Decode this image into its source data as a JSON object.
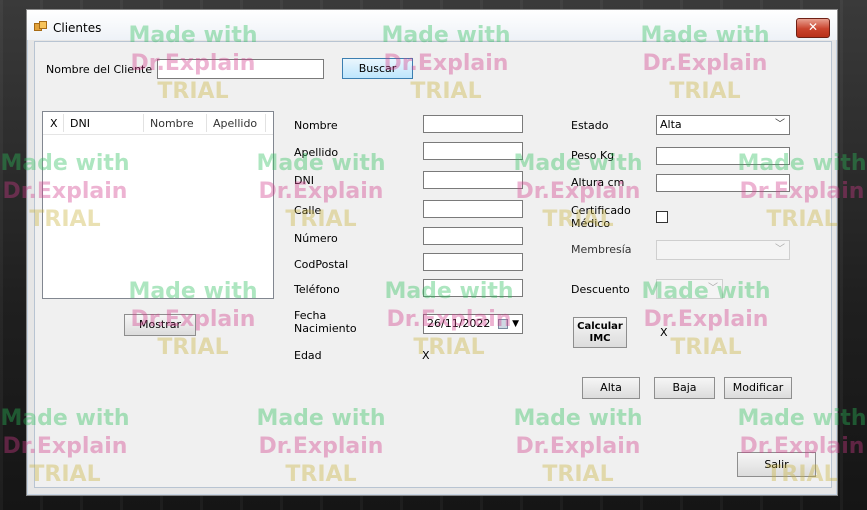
{
  "window": {
    "title": "Clientes",
    "close_glyph": "✕"
  },
  "search": {
    "label": "Nombre del Cliente",
    "value": "",
    "button": "Buscar"
  },
  "listview": {
    "columns": [
      "X",
      "DNI",
      "Nombre",
      "Apellido"
    ],
    "rows": []
  },
  "mostrar_button": "Mostrar",
  "fields": {
    "nombre": {
      "label": "Nombre",
      "value": ""
    },
    "apellido": {
      "label": "Apellido",
      "value": ""
    },
    "dni": {
      "label": "DNI",
      "value": ""
    },
    "calle": {
      "label": "Calle",
      "value": ""
    },
    "numero": {
      "label": "Número",
      "value": ""
    },
    "codpostal": {
      "label": "CodPostal",
      "value": ""
    },
    "telefono": {
      "label": "Teléfono",
      "value": ""
    },
    "fecha": {
      "label_line1": "Fecha",
      "label_line2": "Nacimiento",
      "value": "26/11/2022"
    },
    "edad": {
      "label": "Edad",
      "value": "X"
    }
  },
  "right": {
    "estado": {
      "label": "Estado",
      "value": "Alta"
    },
    "peso": {
      "label": "Peso Kg",
      "value": ""
    },
    "altura": {
      "label": "Altura cm",
      "value": ""
    },
    "certificado": {
      "label_line1": "Certificado",
      "label_line2": "Médico",
      "checked": false
    },
    "membresia": {
      "label": "Membresía",
      "value": ""
    },
    "descuento": {
      "label": "Descuento",
      "value": ""
    },
    "calcular": {
      "line1": "Calcular",
      "line2": "IMC"
    },
    "imc_value": "X"
  },
  "actions": {
    "alta": "Alta",
    "baja": "Baja",
    "modificar": "Modificar",
    "salir": "Salir"
  },
  "watermark": {
    "line1": "Made with",
    "line2": "Dr.Explain",
    "line3": "TRIAL"
  }
}
